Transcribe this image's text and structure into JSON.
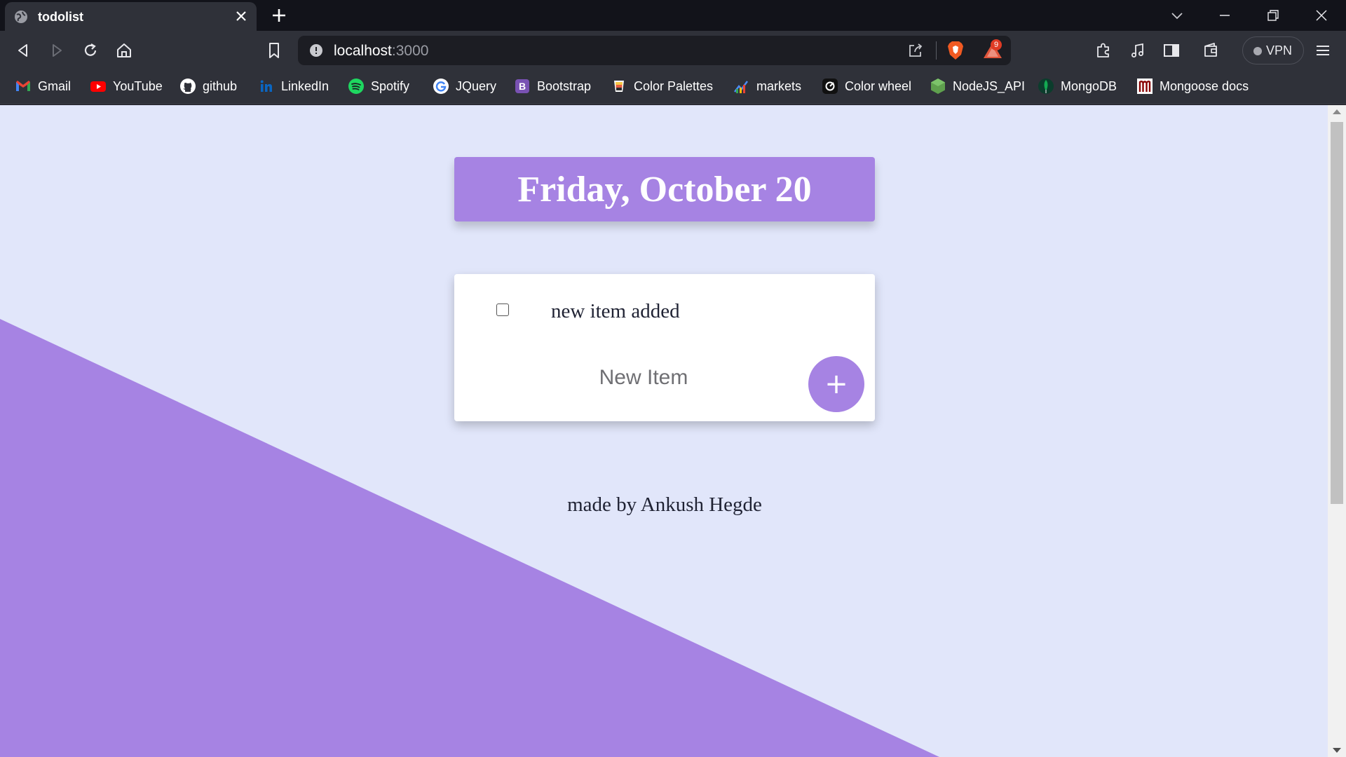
{
  "browser": {
    "tab": {
      "title": "todolist",
      "favicon": "globe-icon"
    },
    "url": {
      "host": "localhost",
      "port": ":3000"
    },
    "rewards_badge": "9",
    "vpn_label": "VPN"
  },
  "bookmarks": [
    {
      "label": "Gmail",
      "icon": "gmail-icon"
    },
    {
      "label": "YouTube",
      "icon": "youtube-icon"
    },
    {
      "label": "github",
      "icon": "github-icon"
    },
    {
      "label": "LinkedIn",
      "icon": "linkedin-icon"
    },
    {
      "label": "Spotify",
      "icon": "spotify-icon"
    },
    {
      "label": "JQuery",
      "icon": "google-icon"
    },
    {
      "label": "Bootstrap",
      "icon": "bootstrap-icon"
    },
    {
      "label": "Color Palettes",
      "icon": "color-palettes-icon"
    },
    {
      "label": "markets",
      "icon": "markets-icon"
    },
    {
      "label": "Color wheel",
      "icon": "color-wheel-icon"
    },
    {
      "label": "NodeJS_API",
      "icon": "nodejs-icon"
    },
    {
      "label": "MongoDB",
      "icon": "mongodb-icon"
    },
    {
      "label": "Mongoose docs",
      "icon": "mongoose-icon"
    }
  ],
  "page": {
    "heading": "Friday, October 20",
    "items": [
      {
        "text": "new item added",
        "checked": false
      }
    ],
    "new_item_placeholder": "New Item",
    "add_button_label": "+",
    "footer": "made by Ankush Hegde"
  },
  "colors": {
    "accent": "#a683e3",
    "page_background": "#e1e6fa",
    "card_background": "#ffffff",
    "browser_chrome": "#2f3139",
    "tabstrip": "#12131a"
  }
}
